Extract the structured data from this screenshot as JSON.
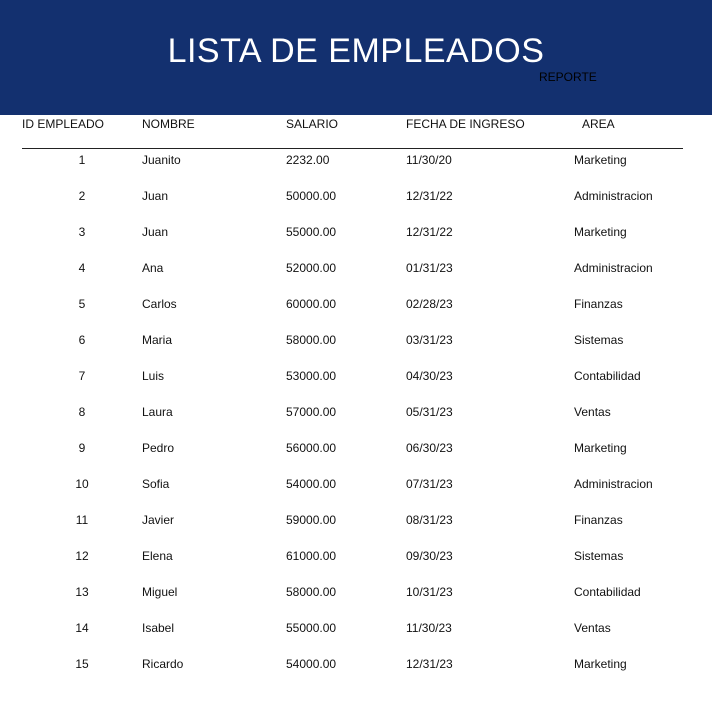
{
  "header": {
    "title": "LISTA DE EMPLEADOS",
    "subtitle": "REPORTE",
    "background_color": "#13306f"
  },
  "table": {
    "columns": [
      "ID EMPLEADO",
      "NOMBRE",
      "SALARIO",
      "FECHA DE INGRESO",
      "AREA"
    ],
    "rows": [
      {
        "id": "1",
        "nombre": "Juanito",
        "salario": "2232.00",
        "fecha": "11/30/20",
        "area": "Marketing"
      },
      {
        "id": "2",
        "nombre": "Juan",
        "salario": "50000.00",
        "fecha": "12/31/22",
        "area": "Administracion"
      },
      {
        "id": "3",
        "nombre": "Juan",
        "salario": "55000.00",
        "fecha": "12/31/22",
        "area": "Marketing"
      },
      {
        "id": "4",
        "nombre": "Ana",
        "salario": "52000.00",
        "fecha": "01/31/23",
        "area": "Administracion"
      },
      {
        "id": "5",
        "nombre": "Carlos",
        "salario": "60000.00",
        "fecha": "02/28/23",
        "area": "Finanzas"
      },
      {
        "id": "6",
        "nombre": "Maria",
        "salario": "58000.00",
        "fecha": "03/31/23",
        "area": "Sistemas"
      },
      {
        "id": "7",
        "nombre": "Luis",
        "salario": "53000.00",
        "fecha": "04/30/23",
        "area": "Contabilidad"
      },
      {
        "id": "8",
        "nombre": "Laura",
        "salario": "57000.00",
        "fecha": "05/31/23",
        "area": "Ventas"
      },
      {
        "id": "9",
        "nombre": "Pedro",
        "salario": "56000.00",
        "fecha": "06/30/23",
        "area": "Marketing"
      },
      {
        "id": "10",
        "nombre": "Sofia",
        "salario": "54000.00",
        "fecha": "07/31/23",
        "area": "Administracion"
      },
      {
        "id": "11",
        "nombre": "Javier",
        "salario": "59000.00",
        "fecha": "08/31/23",
        "area": "Finanzas"
      },
      {
        "id": "12",
        "nombre": "Elena",
        "salario": "61000.00",
        "fecha": "09/30/23",
        "area": "Sistemas"
      },
      {
        "id": "13",
        "nombre": "Miguel",
        "salario": "58000.00",
        "fecha": "10/31/23",
        "area": "Contabilidad"
      },
      {
        "id": "14",
        "nombre": "Isabel",
        "salario": "55000.00",
        "fecha": "11/30/23",
        "area": "Ventas"
      },
      {
        "id": "15",
        "nombre": "Ricardo",
        "salario": "54000.00",
        "fecha": "12/31/23",
        "area": "Marketing"
      }
    ]
  }
}
